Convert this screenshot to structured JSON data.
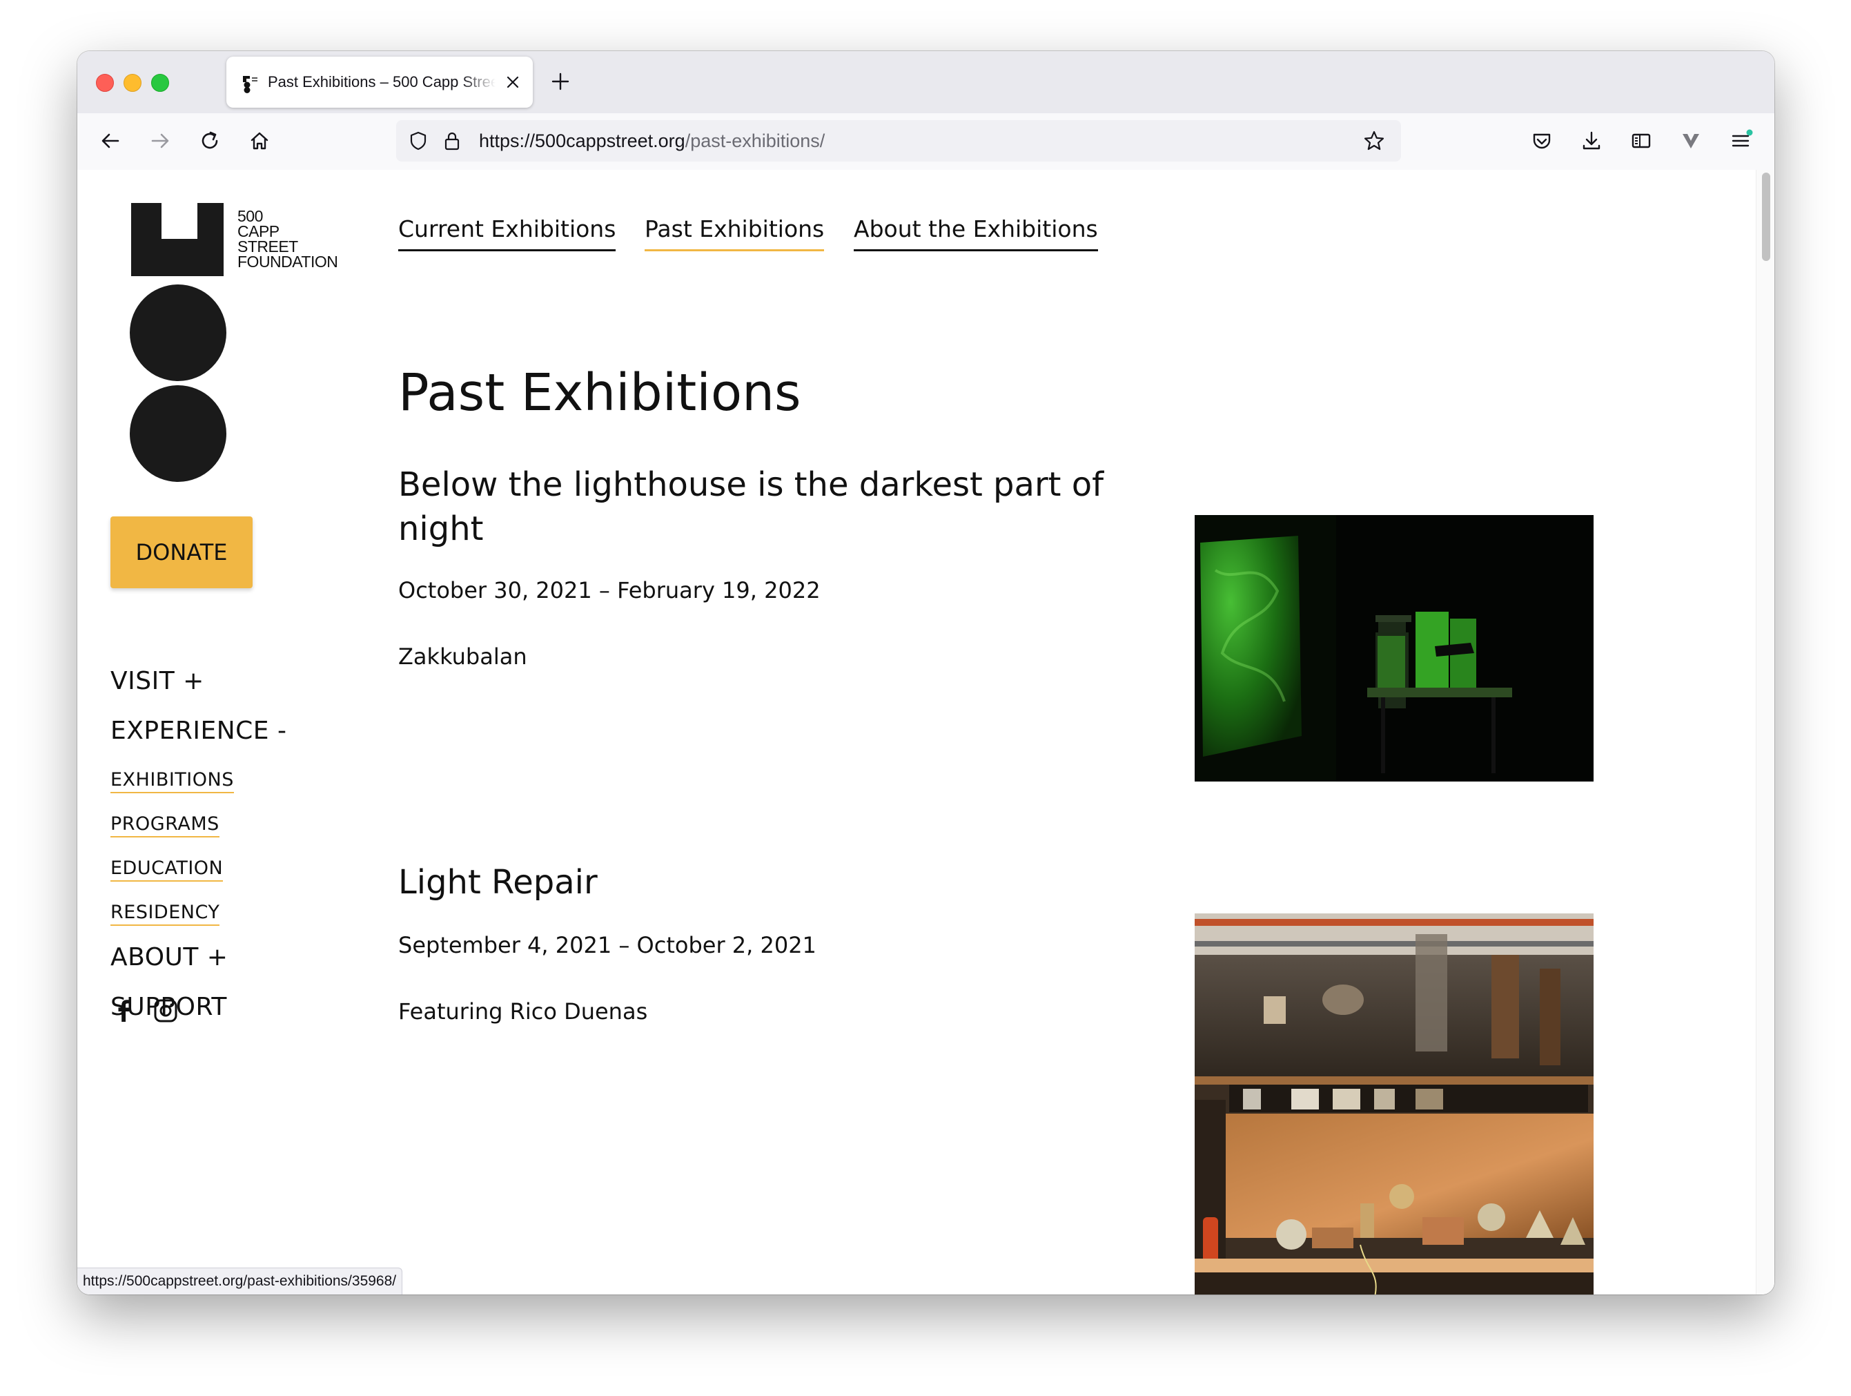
{
  "browser": {
    "tab_title": "Past Exhibitions – 500 Capp Street Foundation",
    "url_host": "https://500cappstreet.org",
    "url_path": "/past-exhibitions/",
    "status_url": "https://500cappstreet.org/past-exhibitions/35968/"
  },
  "site": {
    "logo_lines": [
      "500",
      "CAPP",
      "STREET",
      "FOUNDATION"
    ],
    "donate_label": "DONATE",
    "sidebar": {
      "visit": "VISIT  +",
      "experience": "EXPERIENCE  -",
      "sub_items": [
        "EXHIBITIONS",
        "PROGRAMS",
        "EDUCATION",
        "RESIDENCY"
      ],
      "about": "ABOUT  +",
      "support": "SUPPORT"
    },
    "topnav": [
      "Current Exhibitions",
      "Past Exhibitions",
      "About the Exhibitions"
    ],
    "page_title": "Past Exhibitions",
    "exhibitions": [
      {
        "title": "Below the lighthouse is the darkest part of night",
        "dates": "October 30, 2021 – February 19, 2022",
        "artist": "Zakkubalan"
      },
      {
        "title": "Light Repair",
        "dates": "September 4, 2021 – October 2, 2021",
        "artist": "Featuring Rico Duenas"
      }
    ]
  },
  "colors": {
    "accent": "#f1b744",
    "text": "#111111"
  },
  "icons": {
    "facebook": "facebook-icon",
    "instagram": "instagram-icon"
  }
}
